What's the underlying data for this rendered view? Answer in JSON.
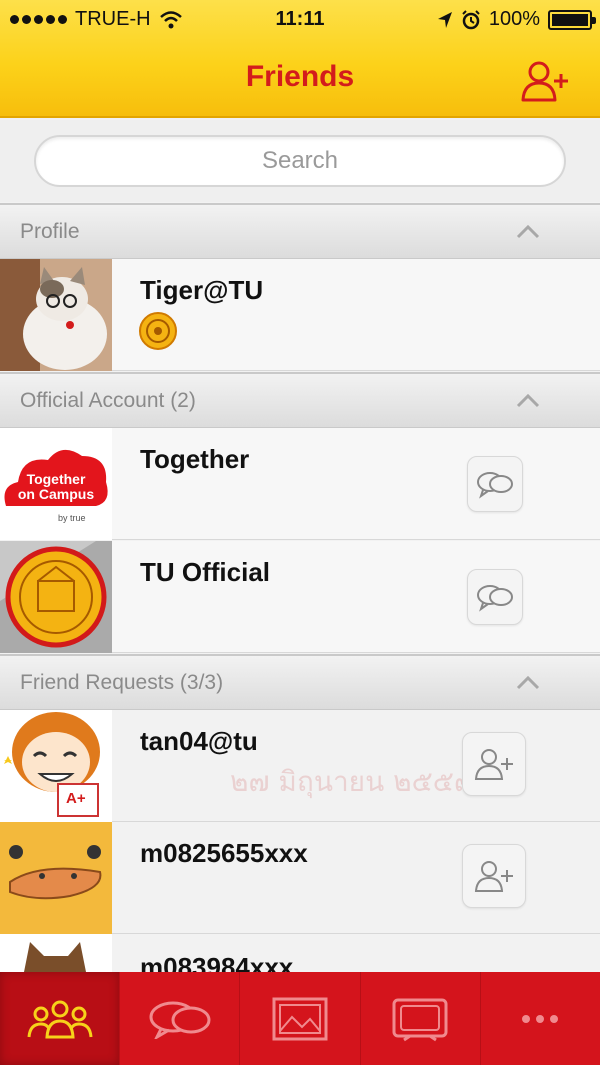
{
  "status_bar": {
    "carrier": "TRUE-H",
    "time": "11:11",
    "battery": "100%"
  },
  "header": {
    "title": "Friends",
    "add_icon": "add-friend-icon"
  },
  "search": {
    "placeholder": "Search"
  },
  "sections": {
    "profile": {
      "label": "Profile"
    },
    "official": {
      "label": "Official Account (2)"
    },
    "requests": {
      "label": "Friend Requests (3/3)"
    }
  },
  "profile": {
    "name": "Tiger@TU"
  },
  "official_accounts": [
    {
      "name": "Together",
      "avatar_text_1": "Together",
      "avatar_text_2": "on Campus",
      "avatar_text_3": "by true"
    },
    {
      "name": "TU Official"
    }
  ],
  "friend_requests": [
    {
      "name": "tan04@tu",
      "sticker_text": "A+"
    },
    {
      "name": "m0825655xxx"
    },
    {
      "name": "m083984xxx"
    }
  ],
  "watermark": {
    "text": "๒๗ มิถุนายน ๒๕๕๗"
  },
  "tabs": [
    {
      "icon": "friends-icon"
    },
    {
      "icon": "chat-icon"
    },
    {
      "icon": "photo-icon"
    },
    {
      "icon": "tv-icon"
    },
    {
      "icon": "more-icon"
    }
  ],
  "colors": {
    "header": "#fcd21a",
    "title": "#d31c1c",
    "tabbar": "#d4141c",
    "active_tab_icon": "#f7d21a"
  }
}
